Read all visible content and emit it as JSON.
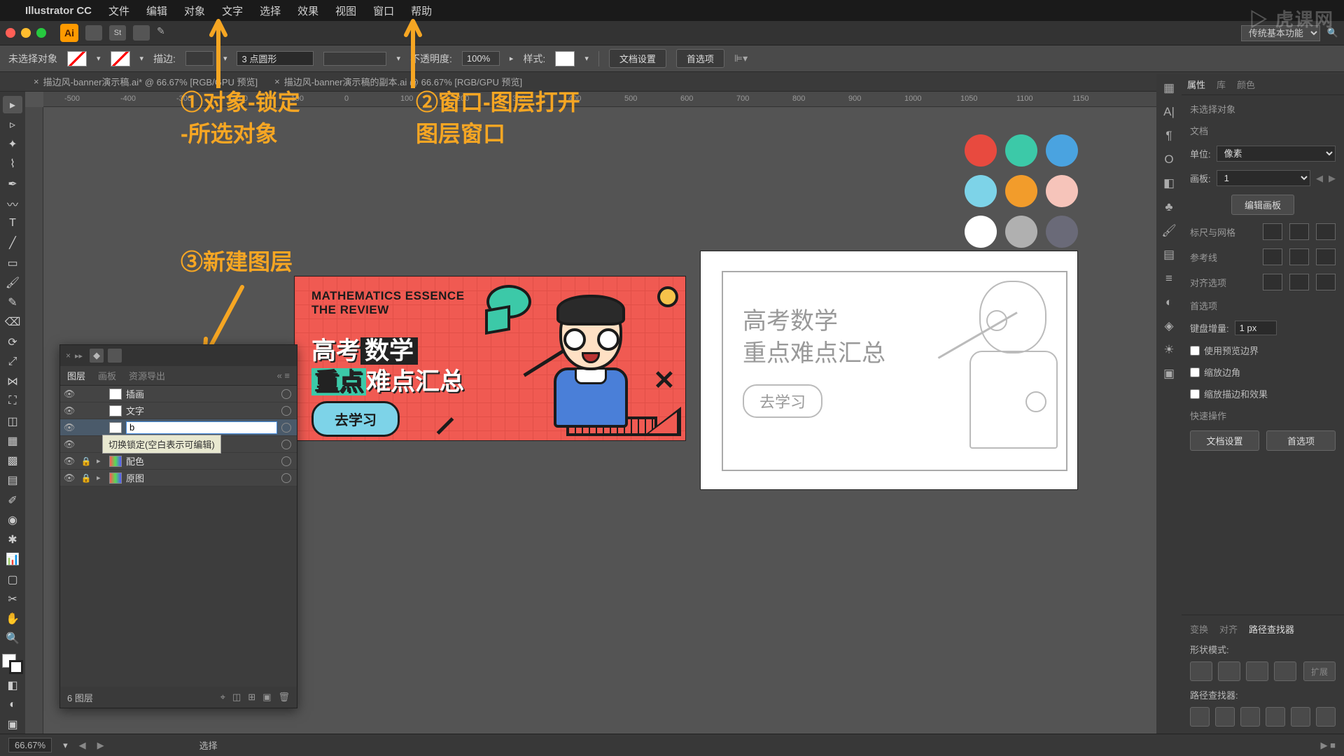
{
  "app": {
    "name": "Illustrator CC"
  },
  "menus": [
    "文件",
    "编辑",
    "对象",
    "文字",
    "选择",
    "效果",
    "视图",
    "窗口",
    "帮助"
  ],
  "appbar": {
    "workspace": "传统基本功能"
  },
  "control": {
    "no_selection": "未选择对象",
    "stroke_label": "描边:",
    "stroke_profile": "3 点圆形",
    "opacity_label": "不透明度:",
    "opacity_value": "100%",
    "style_label": "样式:",
    "doc_setup": "文档设置",
    "prefs": "首选项"
  },
  "tabs": [
    "描边风-banner演示稿.ai* @ 66.67% [RGB/GPU 预览]",
    "描边风-banner演示稿的副本.ai @ 66.67% [RGB/GPU 预览]"
  ],
  "layers": {
    "tabs": [
      "图层",
      "画板",
      "资源导出"
    ],
    "tooltip": "切换锁定(空白表示可编辑)",
    "rows": [
      {
        "name": "插画",
        "locked": false
      },
      {
        "name": "文字",
        "locked": false
      },
      {
        "name": "b",
        "editing": true
      },
      {
        "name": "",
        "locked": false
      },
      {
        "name": "配色",
        "locked": true,
        "hasChildren": true,
        "multi": true
      },
      {
        "name": "原图",
        "locked": true,
        "hasChildren": true,
        "multi": true
      }
    ],
    "footer": "6 图层"
  },
  "properties": {
    "tabs": [
      "属性",
      "库",
      "颜色"
    ],
    "no_sel": "未选择对象",
    "doc": "文档",
    "unit_label": "单位:",
    "unit_value": "像素",
    "artboard_label": "画板:",
    "artboard_value": "1",
    "edit_artboard": "编辑画板",
    "ruler_grid": "标尺与网格",
    "guides": "参考线",
    "align_opts": "对齐选项",
    "prefs_section": "首选项",
    "key_incr_label": "键盘增量:",
    "key_incr_value": "1 px",
    "chk1": "使用预览边界",
    "chk2": "缩放边角",
    "chk3": "缩放描边和效果",
    "quick": "快速操作",
    "btn_doc": "文档设置",
    "btn_prefs": "首选项"
  },
  "pathfinder": {
    "tabs": [
      "变换",
      "对齐",
      "路径查找器"
    ],
    "shape_mode": "形状模式:",
    "pf_label": "路径查找器:",
    "expand": "扩展"
  },
  "status": {
    "zoom": "66.67%",
    "mode": "选择"
  },
  "ruler_ticks": [
    "-500",
    "-400",
    "-300",
    "-200",
    "-100",
    "0",
    "100",
    "200",
    "300",
    "400",
    "500",
    "600",
    "700",
    "800",
    "900",
    "1000",
    "1050",
    "1100",
    "1150"
  ],
  "annotations": {
    "a1": "①对象-锁定\n-所选对象",
    "a2": "②窗口-图层打开\n图层窗口",
    "a3": "③新建图层"
  },
  "artA": {
    "en": "MATHEMATICS ESSENCE\nTHE REVIEW",
    "cn1_pre": "高考",
    "cn1_hl": "数学",
    "cn2_hl": "重点",
    "cn2_post": "难点汇总",
    "cta": "去学习"
  },
  "artB": {
    "line1": "高考数学",
    "line2": "重点难点汇总",
    "btn": "去学习"
  },
  "palette": [
    "#e84a3f",
    "#3cc9a8",
    "#4aa3e0",
    "#7dd3e8",
    "#f29c2b",
    "#f6c4ba",
    "#ffffff",
    "#b0b0b0",
    "#6a6a78"
  ],
  "watermark": "虎课网"
}
